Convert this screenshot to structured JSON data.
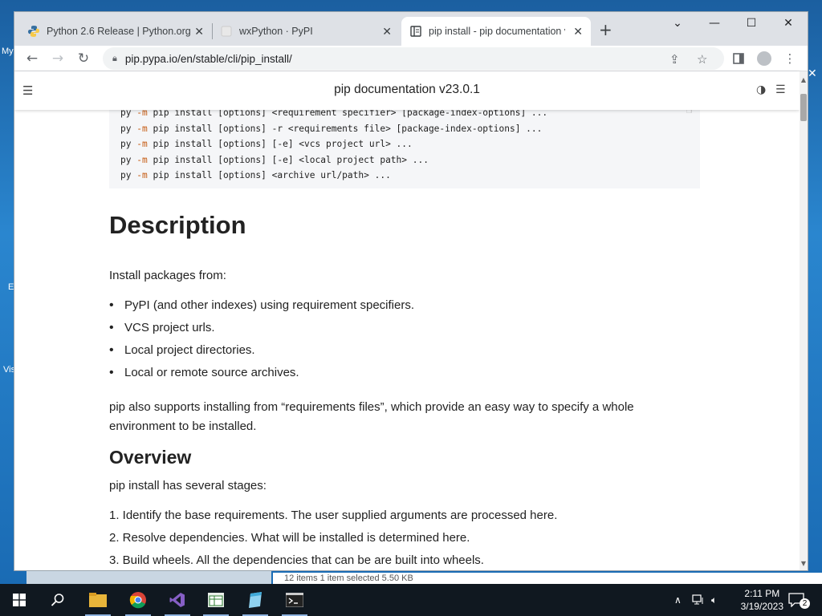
{
  "desktop": {
    "labels": [
      "My",
      "E",
      "Vis"
    ]
  },
  "explorer": {
    "status": "12 items    1 item selected  5.50 KB"
  },
  "browser": {
    "tabs": [
      {
        "title": "Python 2.6 Release | Python.org",
        "icon": "python-icon",
        "active": false
      },
      {
        "title": "wxPython · PyPI",
        "icon": "pypi-icon",
        "active": false
      },
      {
        "title": "pip install - pip documentation v",
        "icon": "docs-icon",
        "active": true
      }
    ],
    "url": "pip.pypa.io/en/stable/cli/pip_install/",
    "window_controls": [
      "chevron-down-icon",
      "minimize-icon",
      "maximize-icon",
      "close-icon"
    ]
  },
  "site": {
    "title": "pip documentation v23.0.1"
  },
  "code_block": {
    "lines": [
      {
        "pre": "py ",
        "m": "-m",
        "rest": " pip install [options] <requirement specifier> [package-index-options] ..."
      },
      {
        "pre": "py ",
        "m": "-m",
        "rest": " pip install [options] -r <requirements file> [package-index-options] ..."
      },
      {
        "pre": "py ",
        "m": "-m",
        "rest": " pip install [options] [-e] <vcs project url> ..."
      },
      {
        "pre": "py ",
        "m": "-m",
        "rest": " pip install [options] [-e] <local project path> ..."
      },
      {
        "pre": "py ",
        "m": "-m",
        "rest": " pip install [options] <archive url/path> ..."
      }
    ]
  },
  "article": {
    "description_heading": "Description",
    "install_intro": "Install packages from:",
    "sources": [
      "PyPI (and other indexes) using requirement specifiers.",
      "VCS project urls.",
      "Local project directories.",
      "Local or remote source archives."
    ],
    "requirements_para_1": "pip also supports installing from “requirements files”, which provide an easy way to specify a whole",
    "requirements_para_2": "environment to be installed.",
    "overview_heading": "Overview",
    "overview_intro": "pip install has several stages:",
    "stages": [
      "1. Identify the base requirements. The user supplied arguments are processed here.",
      "2. Resolve dependencies. What will be installed is determined here.",
      "3. Build wheels. All the dependencies that can be are built into wheels."
    ]
  },
  "taskbar": {
    "clock_time": "2:11 PM",
    "clock_date": "3/19/2023",
    "notification_count": "2",
    "apps": [
      "start-icon",
      "search-icon",
      "file-explorer-icon",
      "chrome-icon",
      "visual-studio-icon",
      "spreadsheet-icon",
      "notepad-icon",
      "terminal-icon"
    ]
  }
}
